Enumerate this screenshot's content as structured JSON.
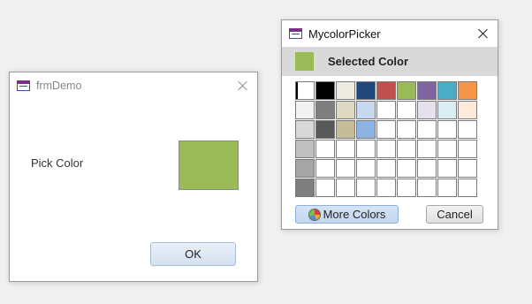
{
  "frmDemo": {
    "title": "frmDemo",
    "pick_label": "Pick Color",
    "selected_color": "#9bbb59",
    "ok_label": "OK"
  },
  "picker": {
    "title": "MycolorPicker",
    "selected_label": "Selected Color",
    "selected_color": "#9bbb59",
    "more_colors_label": "More Colors",
    "cancel_label": "Cancel",
    "palette": [
      [
        "#ffffff",
        "#000000",
        "#eeece1",
        "#1f497d",
        "#c0504d",
        "#9bbb59",
        "#8064a2",
        "#4bacc6",
        "#f79646"
      ],
      [
        "#f2f2f2",
        "#7f7f7f",
        "#ddd9c3",
        "#c6d9f0",
        "#ffffff",
        "#ffffff",
        "#e5e0ec",
        "#dbeef3",
        "#fdeada"
      ],
      [
        "#d8d8d8",
        "#595959",
        "#c4bd97",
        "#8db3e2",
        "#ffffff",
        "#ffffff",
        "#ffffff",
        "#ffffff",
        "#ffffff"
      ],
      [
        "#bfbfbf",
        "#ffffff",
        "#ffffff",
        "#ffffff",
        "#ffffff",
        "#ffffff",
        "#ffffff",
        "#ffffff",
        "#ffffff"
      ],
      [
        "#a5a5a5",
        "#ffffff",
        "#ffffff",
        "#ffffff",
        "#ffffff",
        "#ffffff",
        "#ffffff",
        "#ffffff",
        "#ffffff"
      ],
      [
        "#7f7f7f",
        "#ffffff",
        "#ffffff",
        "#ffffff",
        "#ffffff",
        "#ffffff",
        "#ffffff",
        "#ffffff",
        "#ffffff"
      ]
    ],
    "selected_cell": [
      0,
      0
    ]
  }
}
